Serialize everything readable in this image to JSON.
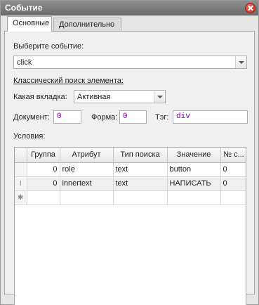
{
  "window": {
    "title": "Событие"
  },
  "tabs": [
    {
      "label": "Основные",
      "active": true
    },
    {
      "label": "Дополнительно",
      "active": false
    }
  ],
  "event": {
    "label": "Выберите событие:",
    "value": "click"
  },
  "search": {
    "heading": "Классический поиск элемента:",
    "tab_label": "Какая вкладка:",
    "tab_value": "Активная",
    "document_label": "Документ:",
    "document_value": "0",
    "form_label": "Форма:",
    "form_value": "0",
    "tag_label": "Тэг:",
    "tag_value": "div"
  },
  "conditions": {
    "label": "Условия:",
    "columns": [
      "Группа",
      "Атрибут",
      "Тип поиска",
      "Значение",
      "№ с..."
    ],
    "rows": [
      {
        "marker": "",
        "group": "0",
        "attribute": "role",
        "search_type": "text",
        "value": "button",
        "number": "0"
      },
      {
        "marker": "I",
        "group": "0",
        "attribute": "innertext",
        "search_type": "text",
        "value": "НАПИСАТЬ",
        "number": "0"
      },
      {
        "marker": "✱",
        "group": "",
        "attribute": "",
        "search_type": "",
        "value": "",
        "number": ""
      }
    ]
  },
  "colors": {
    "titlebar": "#7c7c7c",
    "close": "#d23a2a",
    "field_text": "#7a0099"
  }
}
